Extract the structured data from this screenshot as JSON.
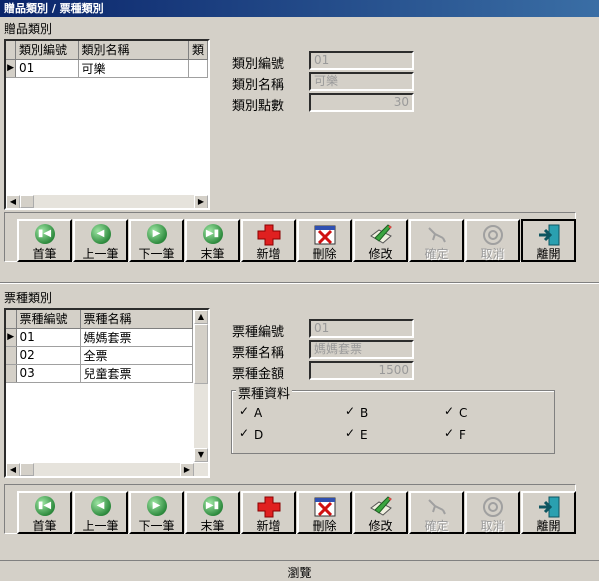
{
  "window": {
    "title": "贈品類別 / 票種類別"
  },
  "gift": {
    "section_label": "贈品類別",
    "columns": [
      "類別編號",
      "類別名稱",
      "類"
    ],
    "rows": [
      {
        "code": "01",
        "name": "可樂"
      }
    ],
    "fields": {
      "code_label": "類別編號",
      "code_value": "01",
      "name_label": "類別名稱",
      "name_value": "可樂",
      "points_label": "類別點數",
      "points_value": "30"
    }
  },
  "ticket": {
    "section_label": "票種類別",
    "columns": [
      "票種編號",
      "票種名稱"
    ],
    "rows": [
      {
        "code": "01",
        "name": "媽媽套票"
      },
      {
        "code": "02",
        "name": "全票"
      },
      {
        "code": "03",
        "name": "兒童套票"
      }
    ],
    "fields": {
      "code_label": "票種編號",
      "code_value": "01",
      "name_label": "票種名稱",
      "name_value": "媽媽套票",
      "amount_label": "票種金額",
      "amount_value": "1500"
    },
    "data_group": {
      "title": "票種資料",
      "options": [
        {
          "label": "A",
          "checked": true
        },
        {
          "label": "B",
          "checked": true
        },
        {
          "label": "C",
          "checked": true
        },
        {
          "label": "D",
          "checked": true
        },
        {
          "label": "E",
          "checked": true
        },
        {
          "label": "F",
          "checked": true
        }
      ]
    }
  },
  "toolbar": {
    "first": "首筆",
    "prev": "上一筆",
    "next": "下一筆",
    "last": "末筆",
    "add": "新增",
    "delete": "刪除",
    "edit": "修改",
    "confirm": "確定",
    "cancel": "取消",
    "exit": "離開"
  },
  "icons": {
    "first": "first-record-icon",
    "prev": "previous-record-icon",
    "next": "next-record-icon",
    "last": "last-record-icon",
    "add": "plus-icon",
    "delete": "delete-x-icon",
    "edit": "edit-pencil-icon",
    "confirm": "confirm-icon",
    "cancel": "cancel-icon",
    "exit": "exit-door-icon"
  },
  "status": {
    "text": "瀏覽"
  },
  "colors": {
    "title_bar": "#0a246a",
    "nav_green": "#2e8b3e",
    "add_red": "#e02020",
    "disabled_text": "#9a9a9a"
  }
}
